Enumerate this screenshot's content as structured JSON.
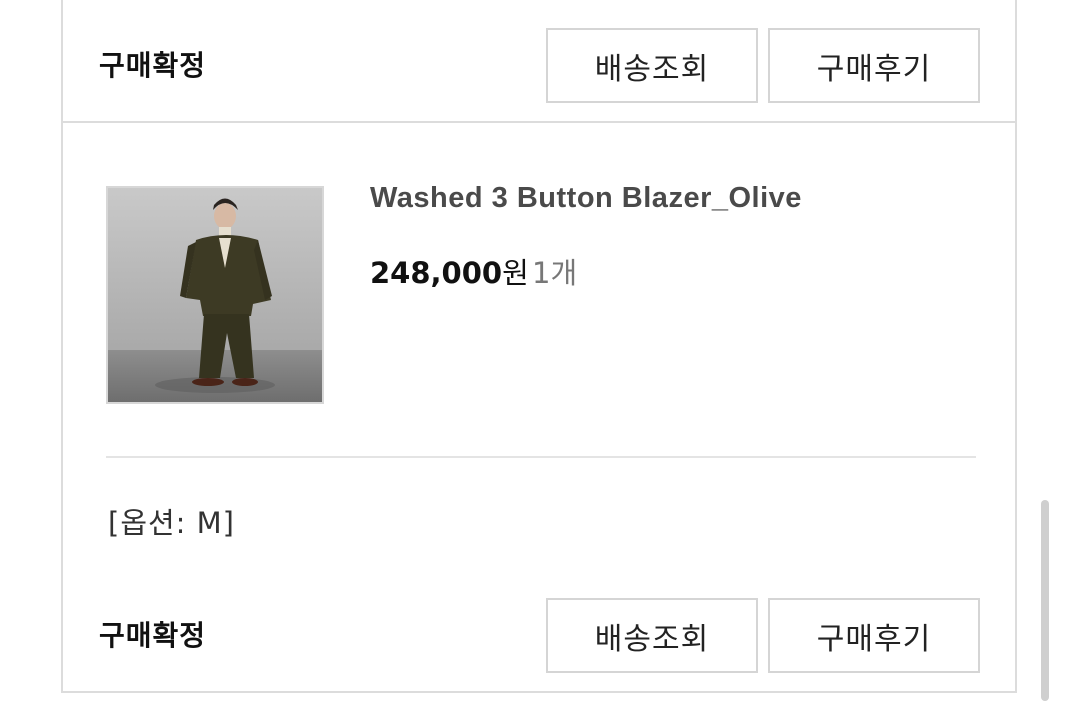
{
  "orders": [
    {
      "status": "구매확정",
      "buttons": {
        "track": "배송조회",
        "review": "구매후기"
      }
    },
    {
      "product": {
        "name": "Washed 3 Button Blazer_Olive",
        "price": "248,000",
        "currency": "원",
        "quantity": "1개",
        "option": "[옵션: M]"
      },
      "status": "구매확정",
      "buttons": {
        "track": "배송조회",
        "review": "구매후기"
      }
    }
  ]
}
